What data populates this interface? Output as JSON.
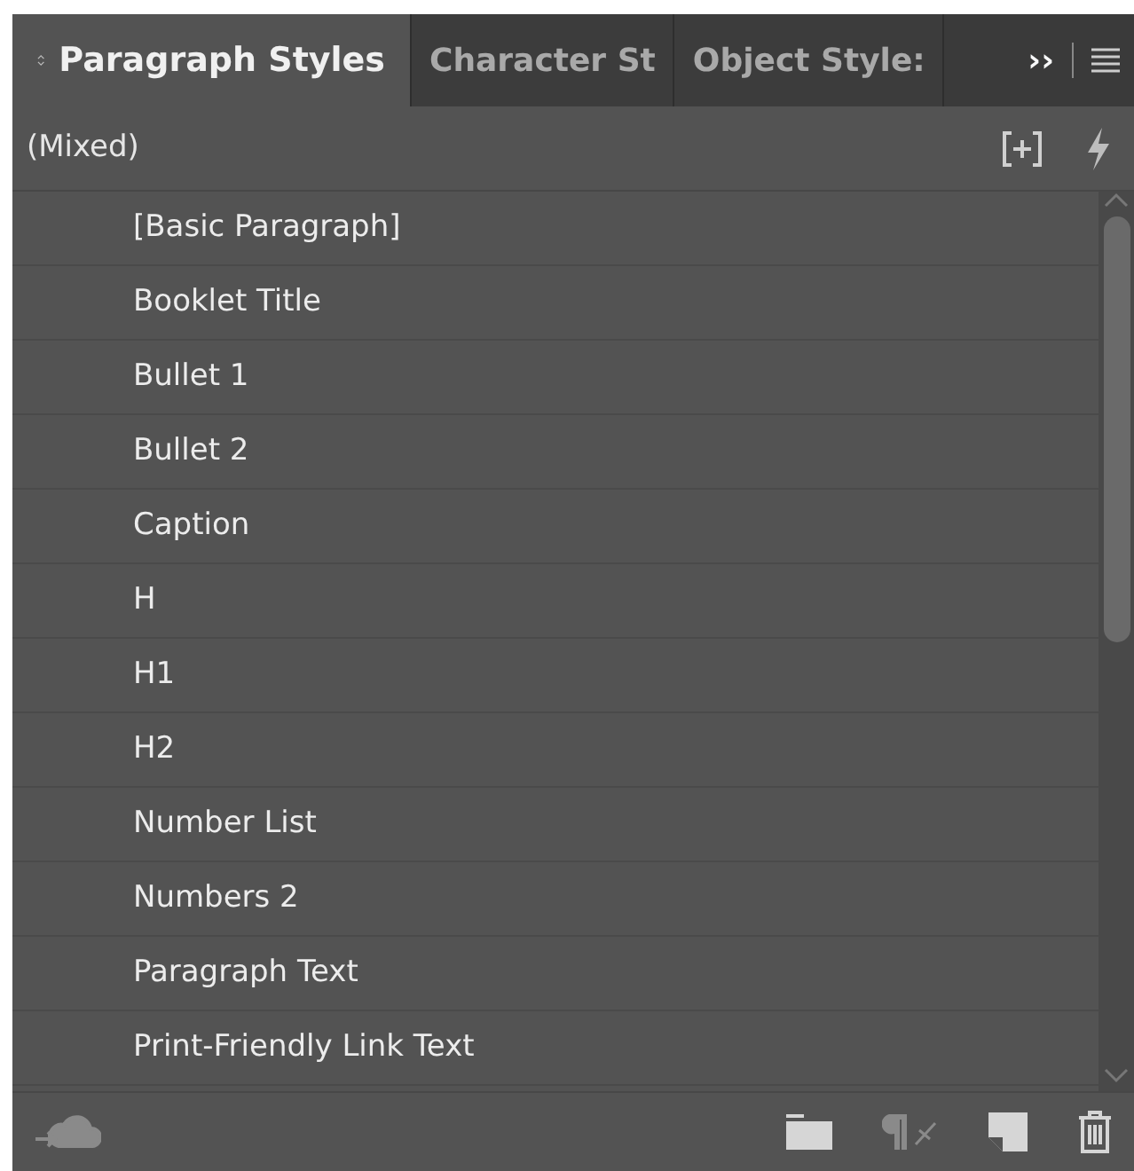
{
  "tabs": [
    {
      "label": "Paragraph Styles",
      "selected": true,
      "kind": "collapsible"
    },
    {
      "label": "Character St",
      "selected": false,
      "kind": "plain"
    },
    {
      "label": "Object Style:",
      "selected": false,
      "kind": "plain"
    }
  ],
  "overflow": "››",
  "current_style": "(Mixed)",
  "styles": [
    "[Basic Paragraph]",
    "Booklet Title",
    "Bullet 1",
    "Bullet 2",
    "Caption",
    "H",
    "H1",
    "H2",
    "Number List",
    "Numbers 2",
    "Paragraph Text",
    "Print-Friendly Link Text"
  ],
  "footer_buttons": [
    {
      "kind": "cloud",
      "disabled": true
    },
    {
      "kind": "folder",
      "disabled": false
    },
    {
      "kind": "clear-overrides",
      "disabled": true
    },
    {
      "kind": "new",
      "disabled": false
    },
    {
      "kind": "trash",
      "disabled": false
    }
  ]
}
